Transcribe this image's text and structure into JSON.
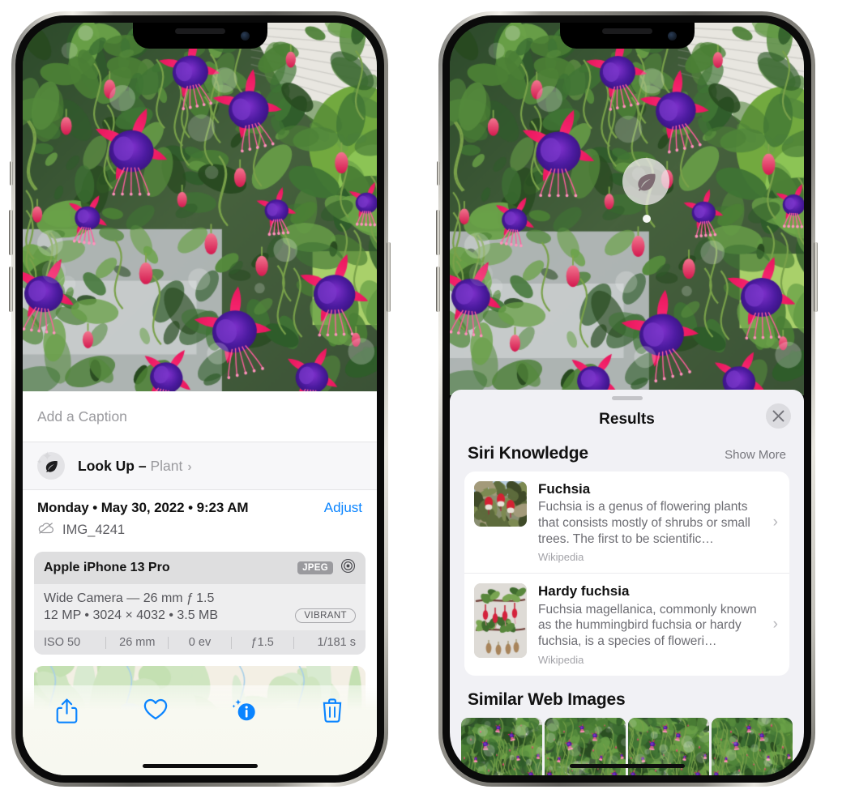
{
  "left_phone": {
    "caption": {
      "placeholder": "Add a Caption",
      "value": ""
    },
    "lookup": {
      "label": "Look Up",
      "dash": "–",
      "subject": "Plant",
      "chevron": "›",
      "icon": "leaf-icon"
    },
    "metadata": {
      "date_line": "Monday • May 30, 2022 • 9:23 AM",
      "adjust_label": "Adjust",
      "filename": "IMG_4241",
      "cloud_icon": "icloud-slash-icon"
    },
    "camera_card": {
      "model": "Apple iPhone 13 Pro",
      "format_tag": "JPEG",
      "aperture_icon": "aperture-icon",
      "lens": "Wide Camera — 26 mm ƒ 1.5",
      "dimensions": "12 MP • 3024 × 4032 • 3.5 MB",
      "style_tag": "VIBRANT",
      "exif": [
        "ISO 50",
        "26 mm",
        "0 ev",
        "ƒ1.5",
        "1/181 s"
      ]
    },
    "toolbar": [
      {
        "name": "share-button",
        "icon": "share-icon"
      },
      {
        "name": "favorite-button",
        "icon": "heart-icon"
      },
      {
        "name": "info-button",
        "icon": "info-sparkle-icon"
      },
      {
        "name": "delete-button",
        "icon": "trash-icon"
      }
    ],
    "accent_color": "#0a84ff"
  },
  "right_phone": {
    "marker": {
      "icon": "leaf-icon",
      "label": "visual-lookup-marker"
    },
    "sheet": {
      "title": "Results",
      "close_label": "✕",
      "sections": [
        {
          "title": "Siri Knowledge",
          "action": "Show More",
          "items": [
            {
              "title": "Fuchsia",
              "description": "Fuchsia is a genus of flowering plants that consists mostly of shrubs or small trees. The first to be scientific…",
              "source": "Wikipedia",
              "chevron": "›"
            },
            {
              "title": "Hardy fuchsia",
              "description": "Fuchsia magellanica, commonly known as the hummingbird fuchsia or hardy fuchsia, is a species of floweri…",
              "source": "Wikipedia",
              "chevron": "›"
            }
          ]
        },
        {
          "title": "Similar Web Images",
          "action": "",
          "images": [
            {
              "alt": "fuchsia-thumb-1"
            },
            {
              "alt": "fuchsia-thumb-2"
            },
            {
              "alt": "fuchsia-thumb-3"
            },
            {
              "alt": "fuchsia-thumb-4"
            }
          ]
        }
      ]
    }
  }
}
